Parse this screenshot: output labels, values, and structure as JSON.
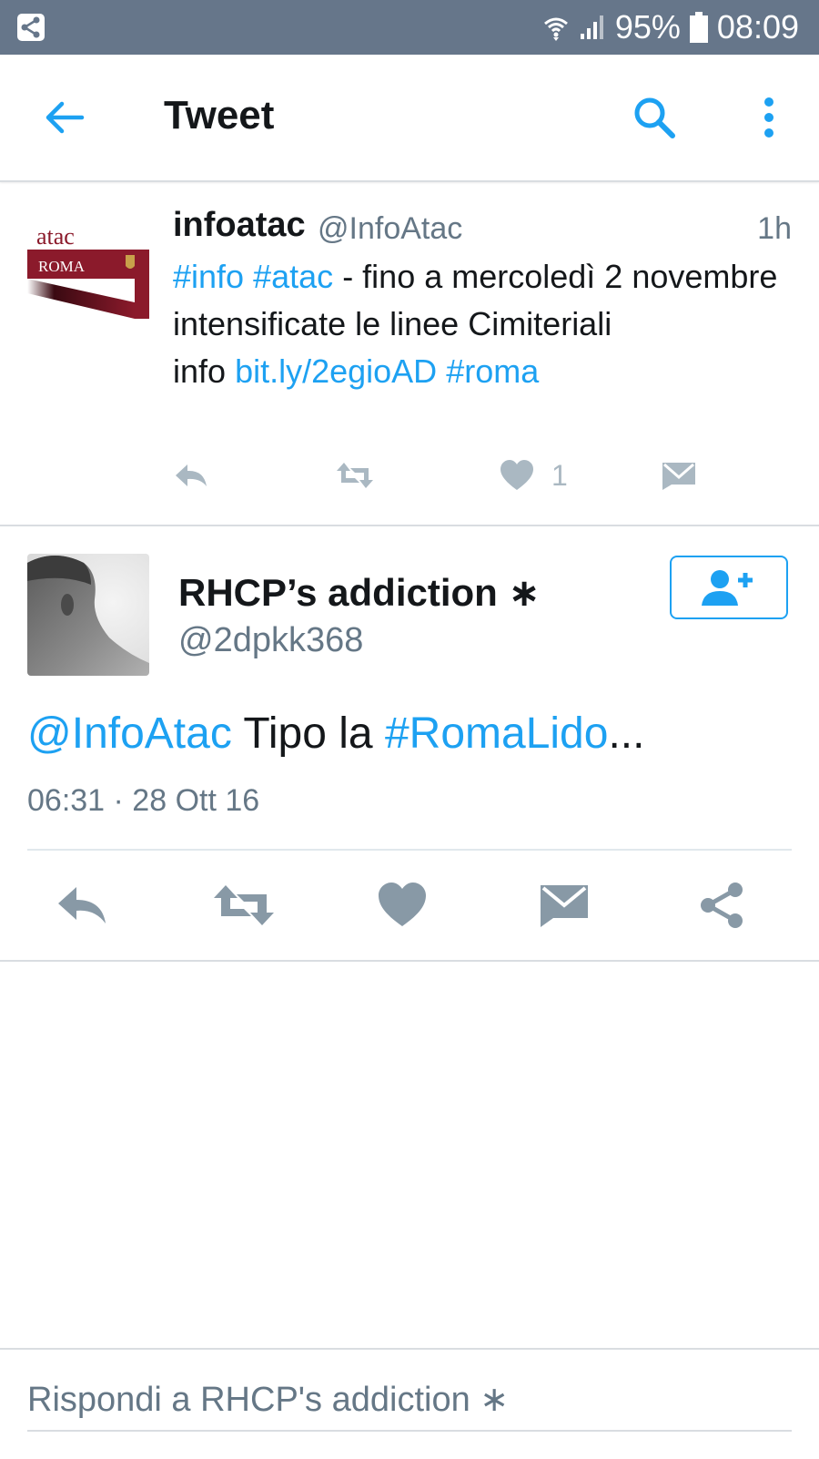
{
  "status_bar": {
    "battery": "95%",
    "time": "08:09",
    "icons": [
      "share-notification-icon",
      "wifi-icon",
      "signal-icon",
      "battery-icon"
    ]
  },
  "app_bar": {
    "title": "Tweet",
    "icons": [
      "back-arrow-icon",
      "search-icon",
      "more-vertical-icon"
    ]
  },
  "tweet_list": {
    "name": "infoatac",
    "handle": "@InfoAtac",
    "time": "1h",
    "avatar_text": [
      "atac",
      "ROMA"
    ],
    "body": {
      "tag1": "#info",
      "tag2": "#atac",
      "text1": "- fino a mercoledì 2 novembre intensificate le linee Cimiteriali",
      "text2": "info",
      "link": "bit.ly/2egioAD",
      "tag3": "#roma"
    },
    "like_count": "1",
    "actions": [
      "reply-icon",
      "retweet-icon",
      "heart-icon",
      "dm-icon"
    ]
  },
  "detail": {
    "name": "RHCP’s addiction ∗",
    "handle": "@2dpkk368",
    "mention": "@InfoAtac",
    "text": "Tipo la",
    "hashtag": "#RomaLido",
    "ellipsis": "...",
    "meta": "06:31 · 28 Ott 16",
    "actions": [
      "reply-icon",
      "retweet-icon",
      "heart-icon",
      "dm-icon",
      "share-icon"
    ]
  },
  "reply": {
    "placeholder": "Rispondi a RHCP's addiction ∗"
  },
  "colors": {
    "accent": "#1da1f2",
    "status_bar": "#66768a",
    "secondary_text": "#657786",
    "action_gray": "#aab8c2",
    "detail_action_gray": "#8899a6",
    "atac_maroon": "#8b1a2b"
  }
}
